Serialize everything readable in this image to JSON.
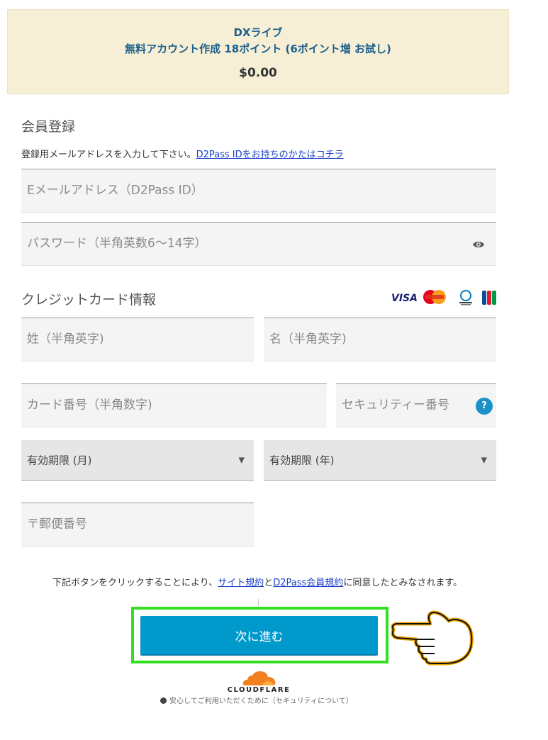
{
  "summary": {
    "product_name": "DXライブ",
    "plan_line": "無料アカウント作成 18ポイント (6ポイント増 お試し)",
    "price": "$0.00"
  },
  "membership": {
    "title": "会員登録",
    "instruction": "登録用メールアドレスを入力して下さい。",
    "d2pass_link": "D2Pass IDをお持ちのかたはコチラ",
    "email_placeholder": "Eメールアドレス（D2Pass ID）",
    "password_placeholder": "パスワード（半角英数6～14字）",
    "password_toggle_icon": "eye-icon"
  },
  "credit_card": {
    "title": "クレジットカード情報",
    "brands": [
      "VISA",
      "MasterCard",
      "Diners Club",
      "JCB"
    ],
    "last_name_placeholder": "姓（半角英字)",
    "first_name_placeholder": "名（半角英字)",
    "card_number_placeholder": "カード番号（半角数字)",
    "security_code_placeholder": "セキュリティー番号",
    "help_label": "?",
    "expiry_month_value": "有効期限 (月)",
    "expiry_year_value": "有効期限 (年)",
    "postal_placeholder": "〒郵便番号"
  },
  "consent": {
    "prefix": "下記ボタンをクリックすることにより、",
    "terms_link": "サイト規約",
    "and": "と",
    "d2pass_terms_link": "D2Pass会員規約",
    "suffix": "に同意したとみなされます。"
  },
  "cta": {
    "label": "次に進む"
  },
  "footer": {
    "cloudflare": "CLOUDFLARE",
    "security_note": "安心してご利用いただくために（セキュリティについて）"
  },
  "colors": {
    "summary_bg": "#f6efd6",
    "link": "#1a3fc8",
    "cta_bg": "#0099cc",
    "highlight_frame": "#32e020",
    "cloudflare_orange": "#f38020"
  }
}
